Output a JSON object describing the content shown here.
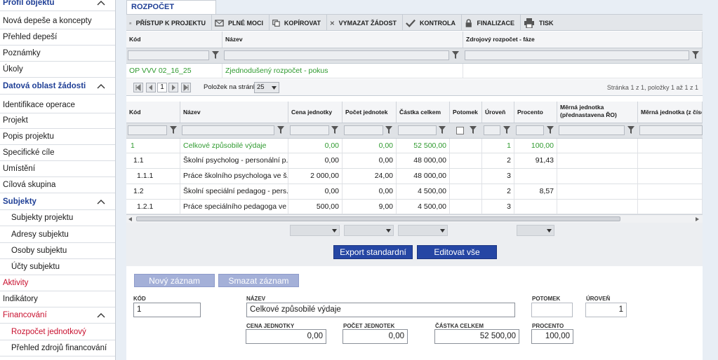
{
  "sidebar": {
    "items": [
      {
        "label": "Profil objektu",
        "kind": "head",
        "collapsible": true
      },
      {
        "label": "Nová depeše a koncepty",
        "kind": "item"
      },
      {
        "label": "Přehled depeší",
        "kind": "item"
      },
      {
        "label": "Poznámky",
        "kind": "item"
      },
      {
        "label": "Úkoly",
        "kind": "item"
      },
      {
        "label": "Datová oblast žádosti",
        "kind": "head",
        "collapsible": true
      },
      {
        "label": "Identifikace operace",
        "kind": "item"
      },
      {
        "label": "Projekt",
        "kind": "item"
      },
      {
        "label": "Popis projektu",
        "kind": "item"
      },
      {
        "label": "Specifické cíle",
        "kind": "item"
      },
      {
        "label": "Umístění",
        "kind": "item"
      },
      {
        "label": "Cílová skupina",
        "kind": "item"
      },
      {
        "label": "Subjekty",
        "kind": "head",
        "collapsible": true
      },
      {
        "label": "Subjekty projektu",
        "kind": "sub"
      },
      {
        "label": "Adresy subjektu",
        "kind": "sub"
      },
      {
        "label": "Osoby subjektu",
        "kind": "sub"
      },
      {
        "label": "Účty subjektu",
        "kind": "sub"
      },
      {
        "label": "Aktivity",
        "kind": "red"
      },
      {
        "label": "Indikátory",
        "kind": "item"
      },
      {
        "label": "Financování",
        "kind": "redhead",
        "collapsible": true
      },
      {
        "label": "Rozpočet jednotkový",
        "kind": "subred"
      },
      {
        "label": "Přehled zdrojů financování",
        "kind": "sub"
      }
    ]
  },
  "tab": {
    "label": "ROZPOČET JEDNOTKOVÝ"
  },
  "toolbar": {
    "buttons": [
      {
        "label": "PŘÍSTUP K PROJEKTU",
        "icon": "people-icon"
      },
      {
        "label": "PLNÉ MOCI",
        "icon": "envelope-icon"
      },
      {
        "label": "KOPÍROVAT",
        "icon": "copy-icon"
      },
      {
        "label": "VYMAZAT ŽÁDOST",
        "icon": "x-icon"
      },
      {
        "label": "KONTROLA",
        "icon": "check-icon"
      },
      {
        "label": "FINALIZACE",
        "icon": "lock-icon"
      },
      {
        "label": "TISK",
        "icon": "printer-icon"
      }
    ]
  },
  "top_grid": {
    "columns": [
      "Kód",
      "Název",
      "Zdrojový rozpočet - fáze"
    ],
    "row": {
      "kod": "OP VVV 02_16_25",
      "nazev": "Zjednodušený rozpočet - pokus",
      "faze": ""
    }
  },
  "pager": {
    "page": "1",
    "per_page_label": "Položek na stránku",
    "per_page_value": "25",
    "summary": "Stránka 1 z 1, položky 1 až 1 z 1"
  },
  "grid": {
    "columns": [
      "Kód",
      "Název",
      "Cena jednotky",
      "Počet jednotek",
      "Částka celkem",
      "Potomek",
      "Úroveň",
      "Procento",
      "Měrná jednotka (přednastavena ŘO)",
      "Měrná jednotka (z číseln"
    ],
    "rows": [
      {
        "kod": "1",
        "nazev": "Celkové způsobilé výdaje",
        "cena": "0,00",
        "pocet": "0,00",
        "castka": "52 500,00",
        "uroven": "1",
        "procento": "100,00",
        "highlight": true
      },
      {
        "kod": "1.1",
        "nazev": "Školní psycholog - personální p...",
        "cena": "0,00",
        "pocet": "0,00",
        "castka": "48 000,00",
        "uroven": "2",
        "procento": "91,43"
      },
      {
        "kod": "1.1.1",
        "nazev": "Práce školního psychologa ve š...",
        "cena": "2 000,00",
        "pocet": "24,00",
        "castka": "48 000,00",
        "uroven": "3",
        "procento": ""
      },
      {
        "kod": "1.2",
        "nazev": "Školní speciální pedagog - pers...",
        "cena": "0,00",
        "pocet": "0,00",
        "castka": "4 500,00",
        "uroven": "2",
        "procento": "8,57"
      },
      {
        "kod": "1.2.1",
        "nazev": "Práce speciálního pedagoga ve ...",
        "cena": "500,00",
        "pocet": "9,00",
        "castka": "4 500,00",
        "uroven": "3",
        "procento": ""
      }
    ]
  },
  "actions": {
    "export": "Export standardní",
    "edit_all": "Editovat vše"
  },
  "form": {
    "new_record": "Nový záznam",
    "delete_record": "Smazat záznam",
    "labels": {
      "kod": "KÓD",
      "nazev": "NÁZEV",
      "potomek": "POTOMEK",
      "uroven": "ÚROVEŇ",
      "cena": "CENA JEDNOTKY",
      "pocet": "POČET JEDNOTEK",
      "castka": "ČÁSTKA CELKEM",
      "procento": "PROCENTO"
    },
    "values": {
      "kod": "1",
      "nazev": "Celkové způsobilé výdaje",
      "potomek": "",
      "uroven": "1",
      "cena": "0,00",
      "pocet": "0,00",
      "castka": "52 500,00",
      "procento": "100,00"
    }
  },
  "colors": {
    "accent": "#1f3f96",
    "button": "#2546a4",
    "green": "#2f9a2f",
    "red": "#c8102e"
  }
}
